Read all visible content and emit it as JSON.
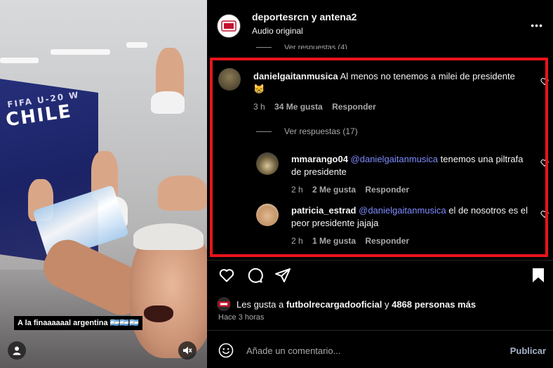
{
  "video": {
    "caption": "A la finaaaaaal argentina 🇦🇷🇦🇷🇦🇷",
    "wall_text_large": "CHILE",
    "wall_text_small": "FIFA U-20 W"
  },
  "header": {
    "title": "deportesrcn y antena2",
    "subtitle": "Audio original",
    "more_label": "•••"
  },
  "comments": {
    "cut_label": "Ver respuestas (4)",
    "main": {
      "username": "danielgaitanmusica",
      "text": "Al menos no tenemos a milei de presidente 😸",
      "time": "3 h",
      "likes": "34 Me gusta",
      "reply": "Responder"
    },
    "view_replies": "Ver respuestas (17)",
    "replies": [
      {
        "username": "mmarango04",
        "mention": "@danielgaitanmusica",
        "text": "tenemos una piltrafa de presidente",
        "time": "2 h",
        "likes": "2 Me gusta",
        "reply": "Responder"
      },
      {
        "username": "patricia_estrad",
        "mention": "@danielgaitanmusica",
        "text": "el de nosotros es el peor presidente jajaja",
        "time": "2 h",
        "likes": "1 Me gusta",
        "reply": "Responder"
      }
    ]
  },
  "likes": {
    "prefix": "Les gusta a ",
    "user": "futbolrecargadooficial",
    "middle": " y ",
    "others": "4868 personas más"
  },
  "time_ago": "Hace 3 horas",
  "add_comment": {
    "placeholder": "Añade un comentario...",
    "post": "Publicar"
  },
  "colors": {
    "highlight": "#e8141c",
    "mention": "#7f8bff",
    "muted": "#a8a8a8",
    "post": "#a5b2c9"
  },
  "icons": [
    "person-icon",
    "mute-icon",
    "heart-icon",
    "comment-icon",
    "share-icon",
    "bookmark-icon",
    "emoji-icon",
    "more-icon"
  ]
}
